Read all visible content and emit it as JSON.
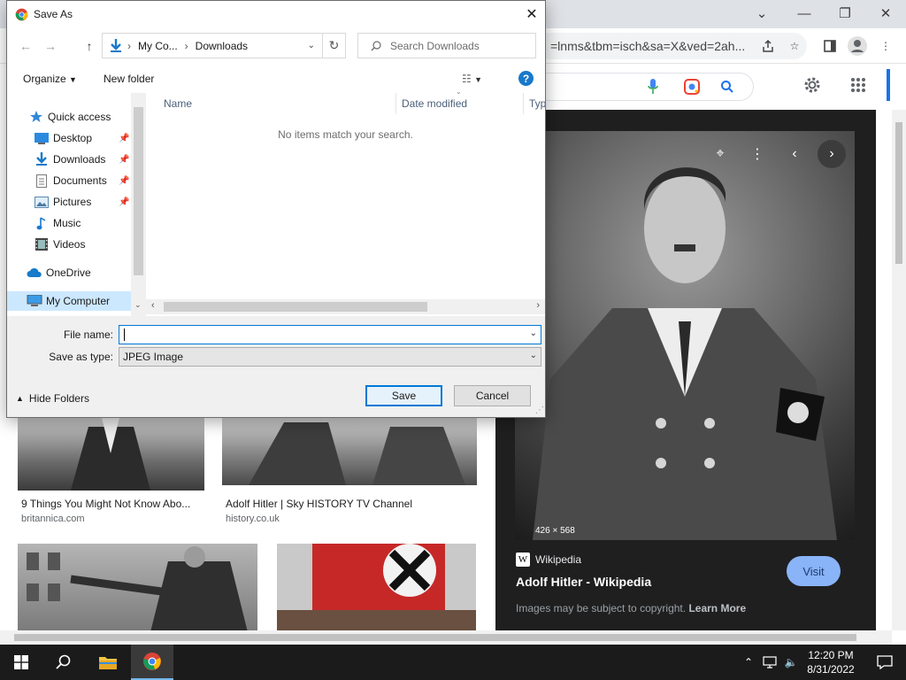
{
  "browser": {
    "omnibox_text": "=lnms&tbm=isch&sa=X&ved=2ah...",
    "colors": {
      "titlebar": "#dee1e6",
      "accent": "#1a73e8"
    }
  },
  "results": [
    {
      "caption": "9 Things You Might Not Know Abo...",
      "source": "britannica.com"
    },
    {
      "caption": "Adolf Hitler | Sky HISTORY TV Channel",
      "source": "history.co.uk"
    }
  ],
  "preview": {
    "dimensions": "426 × 568",
    "source_badge": "W",
    "source": "Wikipedia",
    "title": "Adolf Hitler - Wikipedia",
    "visit_label": "Visit",
    "copyright_note": "Images may be subject to copyright.",
    "learn_more": "Learn More"
  },
  "dialog": {
    "title": "Save As",
    "address": {
      "part1": "My Co...",
      "part2": "Downloads"
    },
    "search_placeholder": "Search Downloads",
    "organize_label": "Organize",
    "new_folder_label": "New folder",
    "help_label": "?",
    "nav": {
      "quick_access": "Quick access",
      "items": [
        "Desktop",
        "Downloads",
        "Documents",
        "Pictures",
        "Music",
        "Videos"
      ],
      "onedrive": "OneDrive",
      "my_computer": "My Computer"
    },
    "columns": {
      "name": "Name",
      "date": "Date modified",
      "type": "Type"
    },
    "empty_message": "No items match your search.",
    "file_name_label": "File name:",
    "file_name_value": "",
    "save_type_label": "Save as type:",
    "save_type_value": "JPEG Image",
    "hide_folders_label": "Hide Folders",
    "save_label": "Save",
    "cancel_label": "Cancel"
  },
  "taskbar": {
    "time": "12:20 PM",
    "date": "8/31/2022"
  }
}
